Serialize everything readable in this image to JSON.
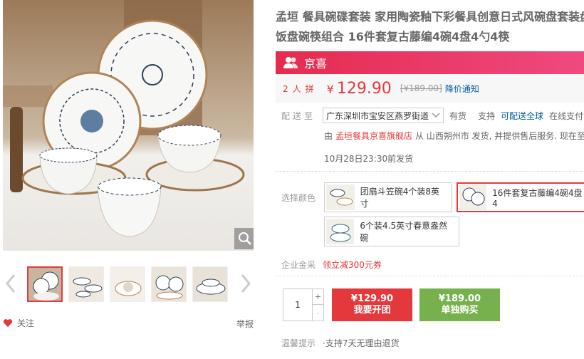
{
  "product": {
    "title_line1": "孟垣 餐具碗碟套装 家用陶瓷釉下彩餐具创意日式风碗盘套装盘",
    "title_line2": "饭盘碗筷组合 16件套复古藤编4碗4盘4勺4筷"
  },
  "promo": {
    "brand": "京喜",
    "icon": "group-people-icon"
  },
  "price": {
    "group_count": "2人拼",
    "yen": "¥",
    "value": "129.90",
    "original": "[¥189.00]",
    "notify": "降价通知"
  },
  "delivery": {
    "label": "配送至",
    "address": "广东深圳市宝安区燕罗街道",
    "stock": "有货",
    "support": "支持",
    "support_link": "可配送全球",
    "online": "在线支付",
    "from_prefix": "由",
    "shop": "孟垣餐具京喜旗舰店",
    "from_suffix": "从 山西朔州市 发货, 并提供售后服务. 现在至",
    "ship_time": "10月28日23:30前发货"
  },
  "options": {
    "label": "选择颜色",
    "items": [
      {
        "label": "团扇斗笠碗4个装8英寸",
        "selected": false
      },
      {
        "label": "16件套复古藤编4碗4盘4",
        "selected": true
      },
      {
        "label": "6个装4.5英寸春意盎然碗",
        "selected": false
      }
    ]
  },
  "enterprise": {
    "label": "企业金采",
    "coupon": "领立减300元券"
  },
  "purchase": {
    "quantity": "1",
    "plus": "+",
    "minus": "-",
    "group_price": "¥129.90",
    "group_label": "我要开团",
    "single_price": "¥189.00",
    "single_label": "单独购买"
  },
  "tips": {
    "label": "温馨提示",
    "text": "·支持7天无理由退货"
  },
  "gallery": {
    "follow": "关注",
    "report": "举报"
  },
  "colors": {
    "accent": "#e4393c",
    "link": "#005aa0",
    "promo_start": "#e52b4f",
    "promo_end": "#ef4a80",
    "single": "#76b14d"
  }
}
